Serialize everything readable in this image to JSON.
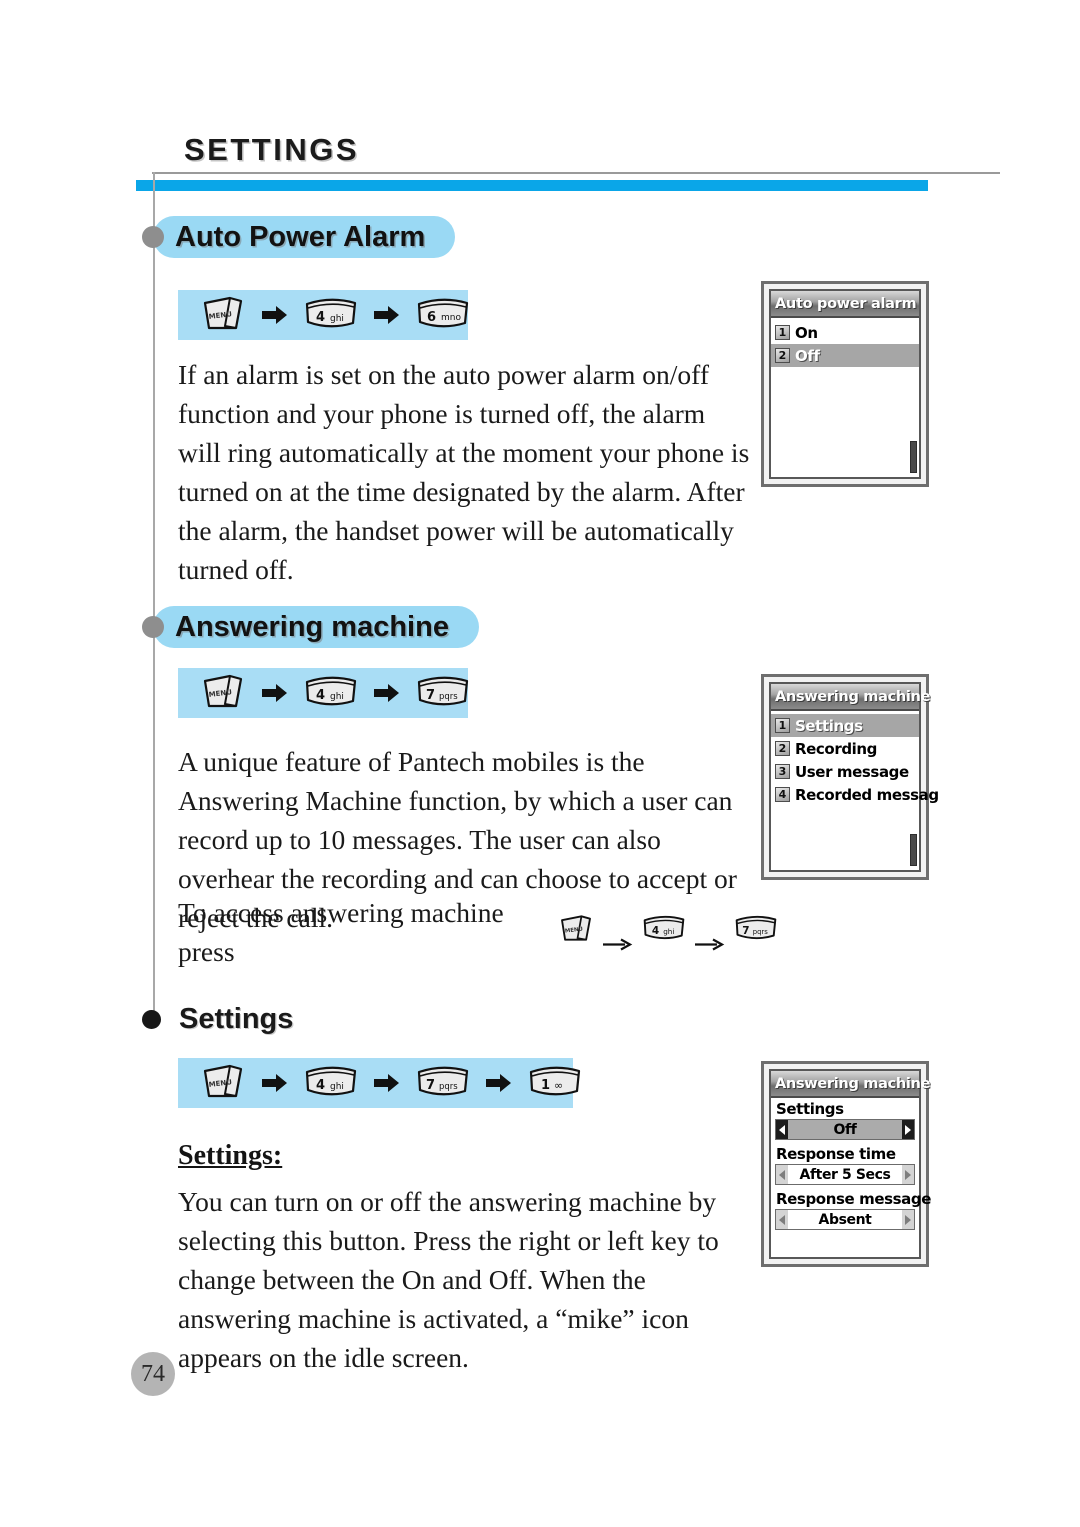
{
  "page": {
    "chapter_title": "SETTINGS",
    "number": "74"
  },
  "sections": [
    {
      "heading": "Auto Power Alarm",
      "keys": [
        "MENU",
        "4 ghi",
        "6 mno"
      ],
      "paragraph": "If an alarm is set on the auto power alarm on/off function and your phone is turned off, the alarm will ring automatically at the moment your phone is turned on at the time designated by the alarm. After the alarm, the handset power will be automatically turned off."
    },
    {
      "heading": "Answering machine",
      "keys": [
        "MENU",
        "4 ghi",
        "7 pqrs"
      ],
      "paragraph": "A unique feature of Pantech mobiles is the Answering Machine function, by which a user can record up to 10 messages. The user can also overhear the recording and can choose to accept or reject the call.",
      "access_line": "To access answering machine press",
      "access_keys": [
        "MENU",
        "4 ghi",
        "7 pqrs"
      ]
    },
    {
      "heading": "Settings",
      "keys": [
        "MENU",
        "4 ghi",
        "7 pqrs",
        "1 ∞"
      ],
      "subheading": "Settings:",
      "paragraph": "You can turn on or off the answering machine by selecting this button. Press the right or left key to change between the On and Off. When the answering machine is activated, a “mike” icon appears on the idle screen."
    }
  ],
  "keycaps": {
    "menu": "MENU",
    "k4": {
      "digit": "4",
      "letters": "ghi"
    },
    "k6": {
      "digit": "6",
      "letters": "mno"
    },
    "k7": {
      "digit": "7",
      "letters": "pqrs"
    },
    "k1": {
      "digit": "1",
      "letters": "∞"
    }
  },
  "screens": [
    {
      "title": "Auto power alarm",
      "type": "list",
      "items": [
        {
          "num": "1",
          "label": "On",
          "selected": false
        },
        {
          "num": "2",
          "label": "Off",
          "selected": true
        }
      ]
    },
    {
      "title": "Answering machine",
      "type": "list",
      "items": [
        {
          "num": "1",
          "label": "Settings",
          "selected": true
        },
        {
          "num": "2",
          "label": "Recording",
          "selected": false
        },
        {
          "num": "3",
          "label": "User message",
          "selected": false
        },
        {
          "num": "4",
          "label": "Recorded messag",
          "selected": false
        }
      ]
    },
    {
      "title": "Answering machine",
      "type": "form",
      "fields": [
        {
          "label": "Settings",
          "value": "Off",
          "selected": true
        },
        {
          "label": "Response time",
          "value": "After 5 Secs",
          "selected": false
        },
        {
          "label": "Response message",
          "value": "Absent",
          "selected": false
        }
      ]
    }
  ],
  "colors": {
    "accent_blue": "#0aa6e8",
    "pill_blue": "#9ad9f4",
    "strip_blue": "#a9ddf5",
    "rule_gray": "#9a9a9a"
  }
}
